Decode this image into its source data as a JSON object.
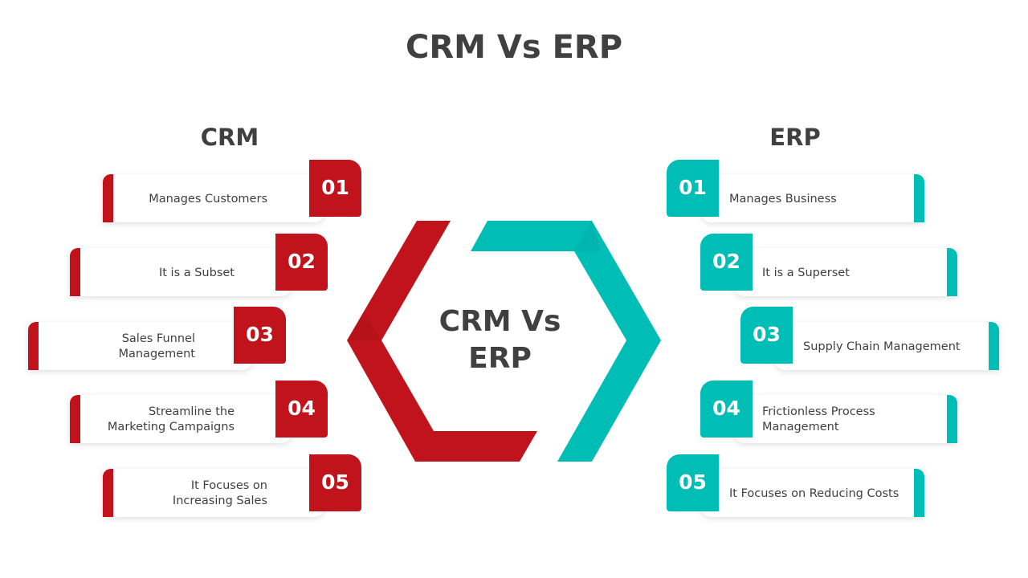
{
  "title": "CRM Vs ERP",
  "colors": {
    "crm": "#c0131b",
    "erp": "#00bdb5",
    "text": "#404040"
  },
  "center": {
    "line1": "CRM Vs",
    "line2": "ERP"
  },
  "crm": {
    "heading": "CRM",
    "items": [
      {
        "number": "01",
        "text": "Manages Customers"
      },
      {
        "number": "02",
        "text": "It is a Subset"
      },
      {
        "number": "03",
        "text": "Sales Funnel Management"
      },
      {
        "number": "04",
        "text": "Streamline the Marketing Campaigns"
      },
      {
        "number": "05",
        "text": "It Focuses on Increasing Sales"
      }
    ]
  },
  "erp": {
    "heading": "ERP",
    "items": [
      {
        "number": "01",
        "text": "Manages Business"
      },
      {
        "number": "02",
        "text": "It is a Superset"
      },
      {
        "number": "03",
        "text": "Supply Chain Management"
      },
      {
        "number": "04",
        "text": "Frictionless Process Management"
      },
      {
        "number": "05",
        "text": "It Focuses on Reducing Costs"
      }
    ]
  }
}
